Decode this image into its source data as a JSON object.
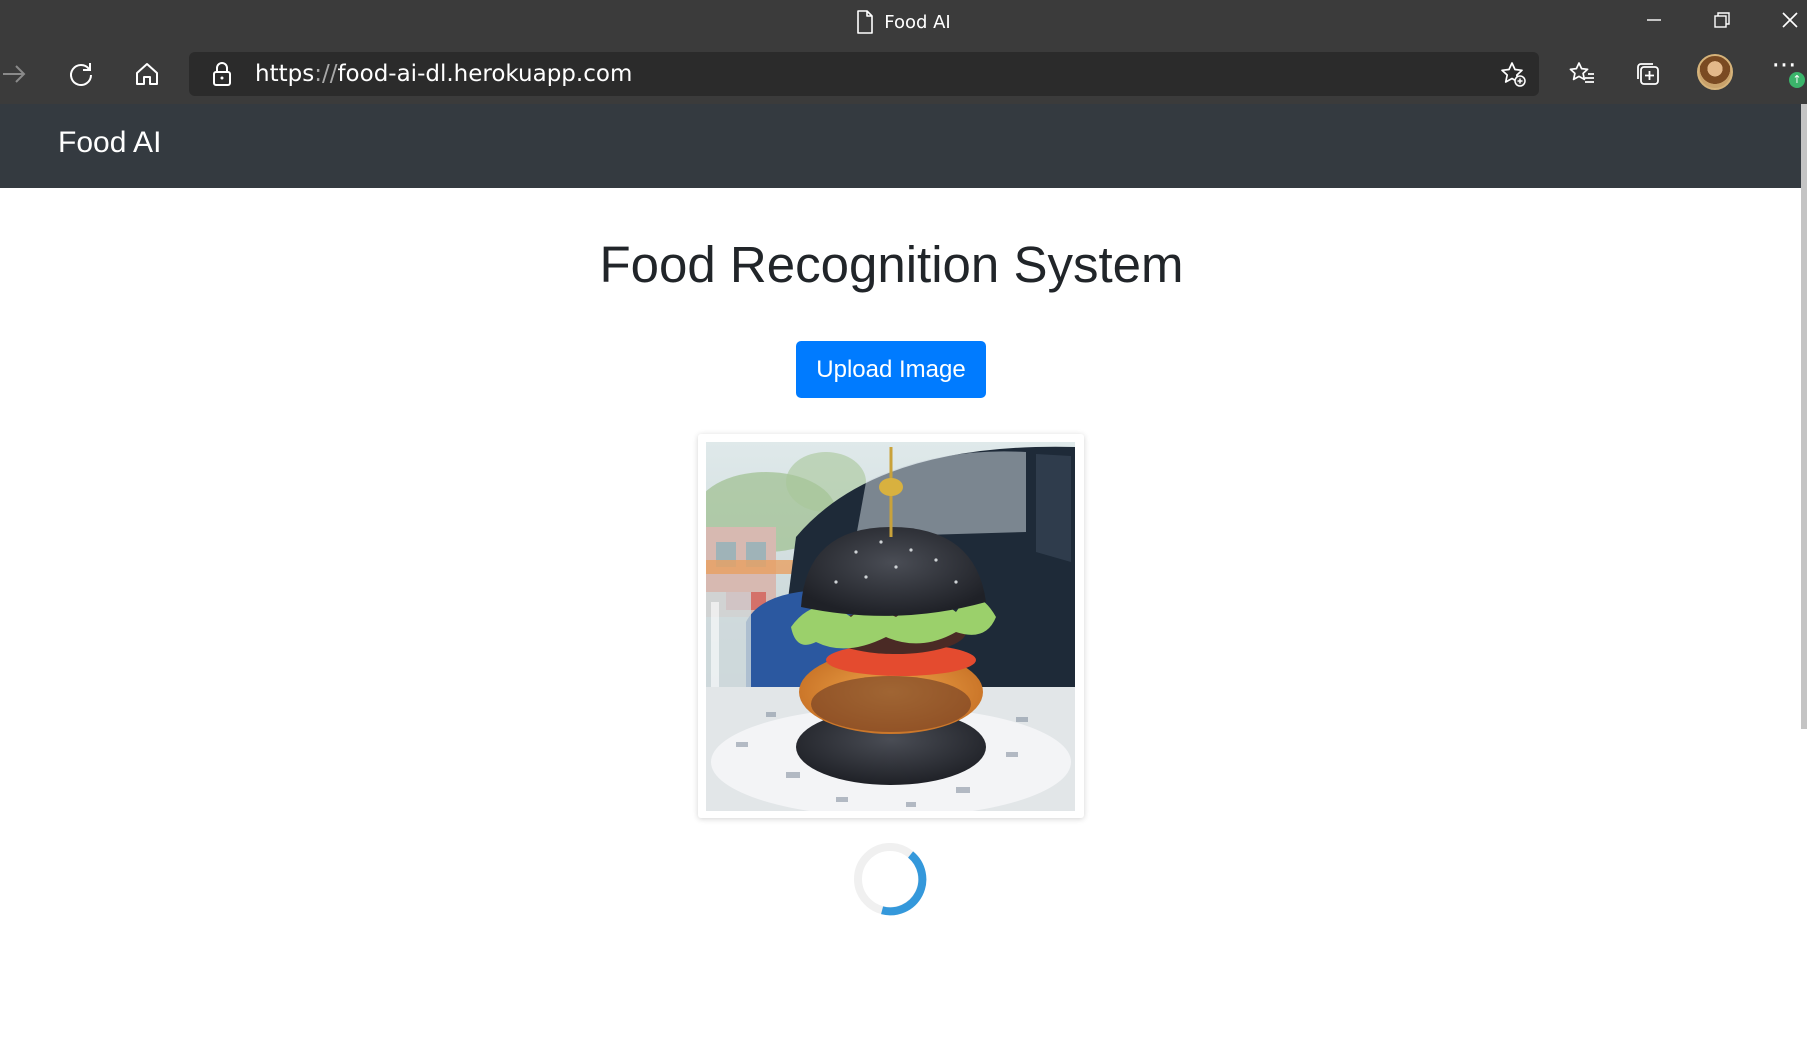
{
  "browser": {
    "window_title": "Food AI",
    "url_scheme": "https",
    "url_sep": "://",
    "url_host": "food-ai-dl.herokuapp.com",
    "notification_badge": "↑"
  },
  "page": {
    "brand": "Food AI",
    "heading": "Food Recognition System",
    "upload_label": "Upload Image"
  },
  "colors": {
    "titlebar": "#3b3b3b",
    "navbar": "#343a40",
    "primary_button": "#007bff",
    "spinner": "#3498db"
  }
}
